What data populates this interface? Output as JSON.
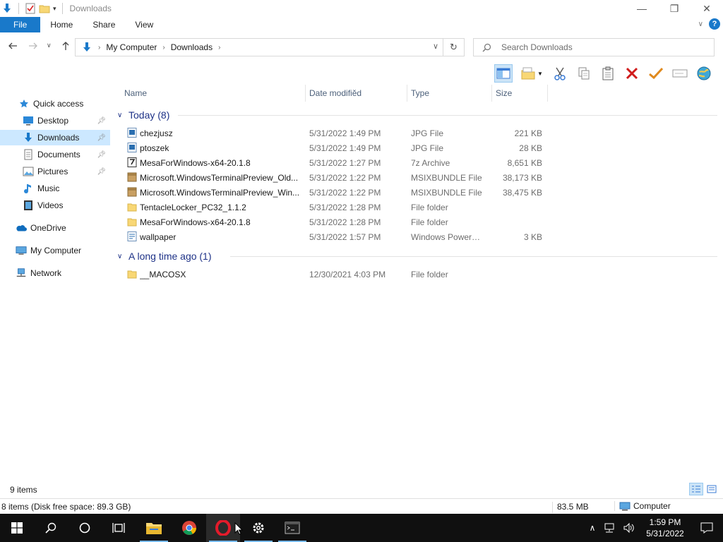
{
  "window": {
    "title": "Downloads",
    "controls": {
      "minimize": "—",
      "maximize": "❐",
      "close": "✕"
    }
  },
  "ribbon": {
    "tabs": [
      "File",
      "Home",
      "Share",
      "View"
    ],
    "help": "?"
  },
  "navigation": {
    "breadcrumbs": [
      "My Computer",
      "Downloads"
    ],
    "search_placeholder": "Search Downloads"
  },
  "sidebar": {
    "items": [
      {
        "label": "Quick access",
        "icon": "star-icon"
      },
      {
        "label": "Desktop",
        "icon": "desktop-icon",
        "pinned": true
      },
      {
        "label": "Downloads",
        "icon": "download-icon",
        "pinned": true,
        "selected": true
      },
      {
        "label": "Documents",
        "icon": "documents-icon",
        "pinned": true
      },
      {
        "label": "Pictures",
        "icon": "pictures-icon",
        "pinned": true
      },
      {
        "label": "Music",
        "icon": "music-icon"
      },
      {
        "label": "Videos",
        "icon": "videos-icon"
      },
      {
        "label": "OneDrive",
        "icon": "cloud-icon"
      },
      {
        "label": "My Computer",
        "icon": "computer-icon"
      },
      {
        "label": "Network",
        "icon": "network-icon"
      }
    ]
  },
  "columns": {
    "name": "Name",
    "date": "Date modified",
    "type": "Type",
    "size": "Size"
  },
  "groups": [
    {
      "label": "Today (8)",
      "files": [
        {
          "name": "chezjusz",
          "date": "5/31/2022 1:49 PM",
          "type": "JPG File",
          "size": "221 KB",
          "icon": "image-file-icon"
        },
        {
          "name": "ptoszek",
          "date": "5/31/2022 1:49 PM",
          "type": "JPG File",
          "size": "28 KB",
          "icon": "image-file-icon"
        },
        {
          "name": "MesaForWindows-x64-20.1.8",
          "date": "5/31/2022 1:27 PM",
          "type": "7z Archive",
          "size": "8,651 KB",
          "icon": "archive-icon"
        },
        {
          "name": "Microsoft.WindowsTerminalPreview_Old...",
          "date": "5/31/2022 1:22 PM",
          "type": "MSIXBUNDLE File",
          "size": "38,173 KB",
          "icon": "package-icon"
        },
        {
          "name": "Microsoft.WindowsTerminalPreview_Win...",
          "date": "5/31/2022 1:22 PM",
          "type": "MSIXBUNDLE File",
          "size": "38,475 KB",
          "icon": "package-icon"
        },
        {
          "name": "TentacleLocker_PC32_1.1.2",
          "date": "5/31/2022 1:28 PM",
          "type": "File folder",
          "size": "",
          "icon": "folder-icon"
        },
        {
          "name": "MesaForWindows-x64-20.1.8",
          "date": "5/31/2022 1:28 PM",
          "type": "File folder",
          "size": "",
          "icon": "folder-icon"
        },
        {
          "name": "wallpaper",
          "date": "5/31/2022 1:57 PM",
          "type": "Windows PowerS...",
          "size": "3 KB",
          "icon": "script-icon"
        }
      ]
    },
    {
      "label": "A long time ago (1)",
      "files": [
        {
          "name": "__MACOSX",
          "date": "12/30/2021 4:03 PM",
          "type": "File folder",
          "size": "",
          "icon": "folder-icon"
        }
      ]
    }
  ],
  "status": {
    "item_count": "9 items",
    "selection_info": "8 items (Disk free space: 89.3 GB)",
    "total_size": "83.5 MB",
    "location": "Computer"
  },
  "clock": {
    "time": "1:59 PM",
    "date": "5/31/2022"
  },
  "colors": {
    "accent": "#1979ca",
    "selection": "#cce8ff",
    "group_header": "#1e3287",
    "folder": "#f8d775"
  }
}
